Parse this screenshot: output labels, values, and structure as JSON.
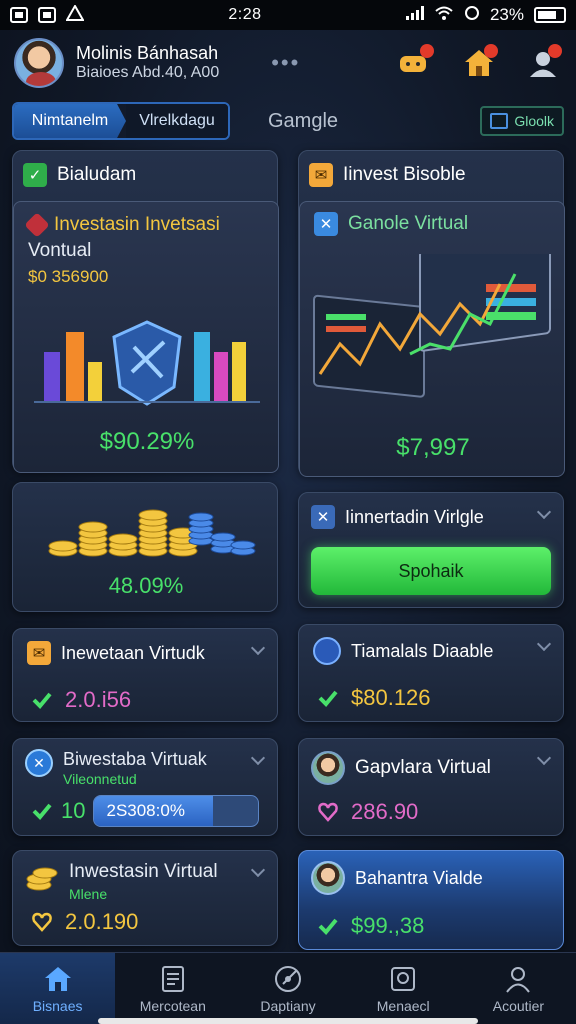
{
  "status_bar": {
    "left_icons": [
      "notification-icon",
      "photo-icon",
      "alert-icon"
    ],
    "time": "2:28",
    "right_icons": [
      "signal-icon",
      "wifi-icon",
      "sync-icon",
      "battery-icon"
    ],
    "battery": "23%"
  },
  "header": {
    "user_name": "Molinis Bánhasah",
    "user_sub": "Biaioes Abd.40, A00",
    "more": "•••"
  },
  "tabs": {
    "tab1": "Nimtanelm",
    "tab2": "Vlrelkdagu",
    "tab3": "Gamgle",
    "tab4": "Gloolk"
  },
  "cards": {
    "balance": {
      "title": "Bialudam",
      "inner_title": "Investasin Invetsasi",
      "inner_subtitle": "Vontual",
      "amount": "$0 356900",
      "value": "$90.29%"
    },
    "invest": {
      "title": "Iinvest Bisoble",
      "inner_title": "Ganole Virtual",
      "value": "$7,997"
    },
    "coins": {
      "value": "48.09%"
    },
    "action": {
      "title": "Iinnertadin Virlgle",
      "button": "Spohaik"
    },
    "row1_left": {
      "title": "Inewetaan Virtudk",
      "value": "2.0.i56"
    },
    "row1_right": {
      "title": "Tiamalals Diaable",
      "value": "$80.126"
    },
    "row2_left": {
      "title": "Biwestaba Virtuak",
      "subtitle": "Vileonnetud",
      "prefix": "10",
      "progress_text": "2S308:0%",
      "progress": 0.72
    },
    "row2_right": {
      "title": "Gapvlara Virtual",
      "value": "286.90"
    },
    "row3_left": {
      "title": "Inwestasin Virtual",
      "subtitle": "Mlene",
      "value": "2.0.190"
    },
    "row3_right": {
      "title": "Bahantra Vialde",
      "value": "$99.,38"
    }
  },
  "bottom_nav": [
    {
      "label": "Bisnaes",
      "icon": "home-icon",
      "active": true
    },
    {
      "label": "Mercotean",
      "icon": "document-icon",
      "active": false
    },
    {
      "label": "Daptiany",
      "icon": "target-icon",
      "active": false
    },
    {
      "label": "Menaecl",
      "icon": "photo-frame-icon",
      "active": false
    },
    {
      "label": "Acoutier",
      "icon": "user-icon",
      "active": false
    }
  ],
  "colors": {
    "accent_green": "#48e06a",
    "accent_yellow": "#f3c640",
    "accent_pink": "#e26bc8",
    "accent_blue": "#2b6cc0"
  }
}
